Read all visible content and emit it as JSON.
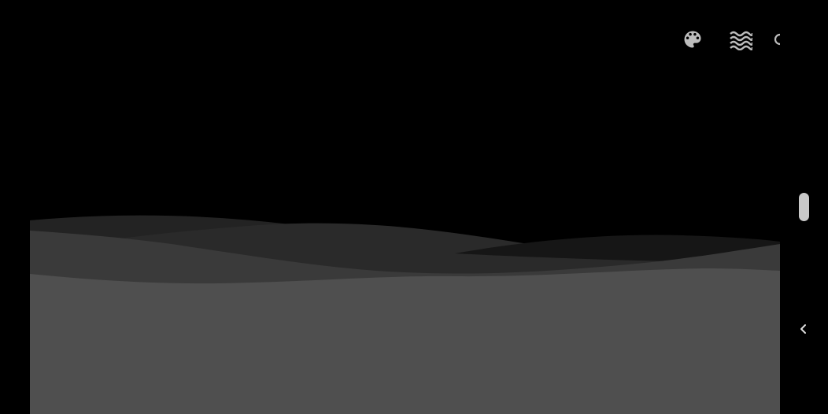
{
  "canvas": {
    "background": "#000000",
    "wave_colors": [
      "#232323",
      "#2a2a2a",
      "#161616",
      "#3a3a3a",
      "#4f4f4f"
    ]
  },
  "toolbar": {
    "items": [
      {
        "icon": "palette-icon"
      },
      {
        "icon": "waves-icon"
      },
      {
        "icon": "partial-icon"
      }
    ],
    "icon_color": "#bdbdbd"
  },
  "rail": {
    "scroll_thumb_color": "#c9c9c9",
    "collapse_icon": "chevron-left-icon"
  }
}
